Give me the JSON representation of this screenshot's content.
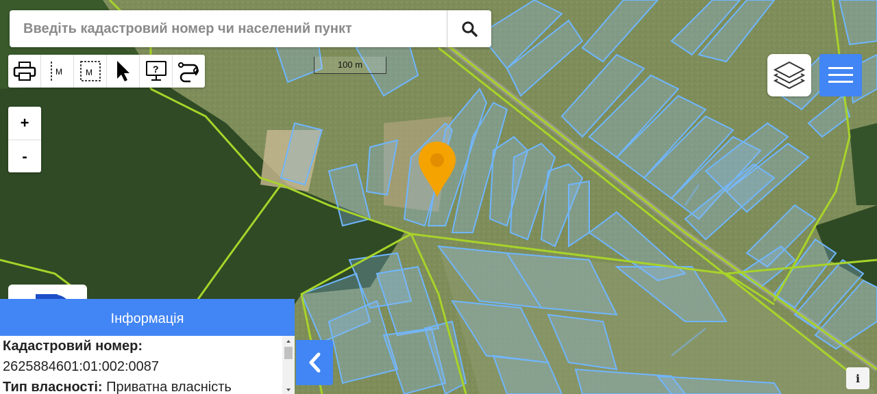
{
  "search": {
    "placeholder": "Введіть кадастровий номер чи населений пункт",
    "button_icon": "search-icon"
  },
  "toolbar": {
    "tools": [
      {
        "icon": "print-icon"
      },
      {
        "icon": "measure-distance-icon",
        "label": "M"
      },
      {
        "icon": "measure-area-icon",
        "label": "M"
      },
      {
        "icon": "pointer-icon"
      },
      {
        "icon": "identify-help-icon",
        "label": "?"
      },
      {
        "icon": "route-icon"
      }
    ]
  },
  "scale_label": "100 m",
  "zoom": {
    "in_label": "+",
    "out_label": "-"
  },
  "top_right": {
    "layers_icon": "layers-icon",
    "menu_icon": "hamburger-menu-icon"
  },
  "colors": {
    "accent": "#4285f4",
    "parcel_outline": "#6fb6ff",
    "boundary": "#a8d32a",
    "marker": "#f5a300"
  },
  "info_panel": {
    "title": "Інформація",
    "cadastral_label": "Кадастровий номер:",
    "cadastral_value": "2625884601:01:002:0087",
    "ownership_label": "Тип власності:",
    "ownership_value": "Приватна власність"
  },
  "info_button_label": "i"
}
